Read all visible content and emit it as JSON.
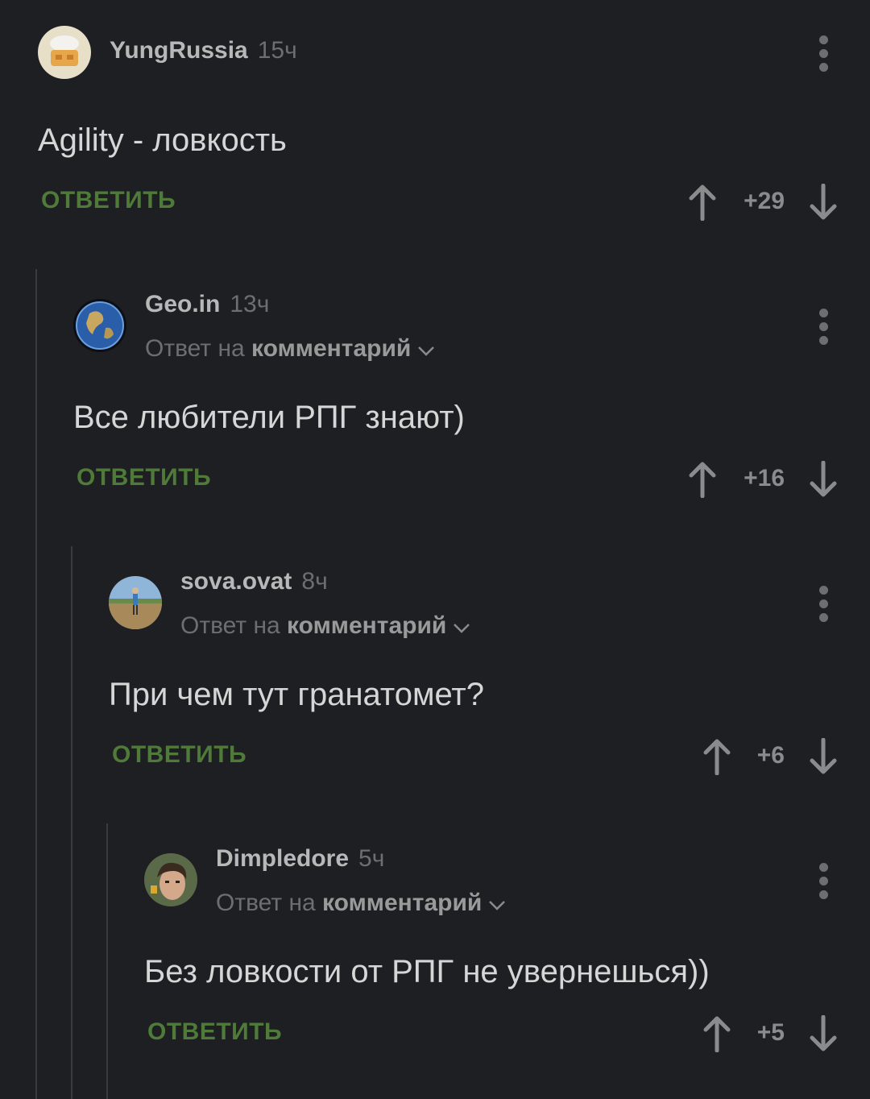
{
  "comments": [
    {
      "author": "YungRussia",
      "time": "15ч",
      "reply_prefix": "",
      "reply_target": "",
      "text": "Agility - ловкость",
      "reply_label": "ОТВЕТИТЬ",
      "score": "+29",
      "avatar_icon": "chef-hat-avatar"
    },
    {
      "author": "Geo.in",
      "time": "13ч",
      "reply_prefix": "Ответ на",
      "reply_target": "комментарий",
      "text": "Все любители РПГ знают)",
      "reply_label": "ОТВЕТИТЬ",
      "score": "+16",
      "avatar_icon": "earth-globe-avatar"
    },
    {
      "author": "sova.ovat",
      "time": "8ч",
      "reply_prefix": "Ответ на",
      "reply_target": "комментарий",
      "text": "При чем тут гранатомет?",
      "reply_label": "ОТВЕТИТЬ",
      "score": "+6",
      "avatar_icon": "person-in-field-avatar"
    },
    {
      "author": "Dimpledore",
      "time": "5ч",
      "reply_prefix": "Ответ на",
      "reply_target": "комментарий",
      "text": "Без ловкости от РПГ не увернешься))",
      "reply_label": "ОТВЕТИТЬ",
      "score": "+5",
      "avatar_icon": "face-photo-avatar"
    }
  ],
  "colors": {
    "background": "#1e1f22",
    "accent_green": "#4f7a39",
    "muted": "#6d6e70",
    "thread_line": "#3a3b3e"
  }
}
